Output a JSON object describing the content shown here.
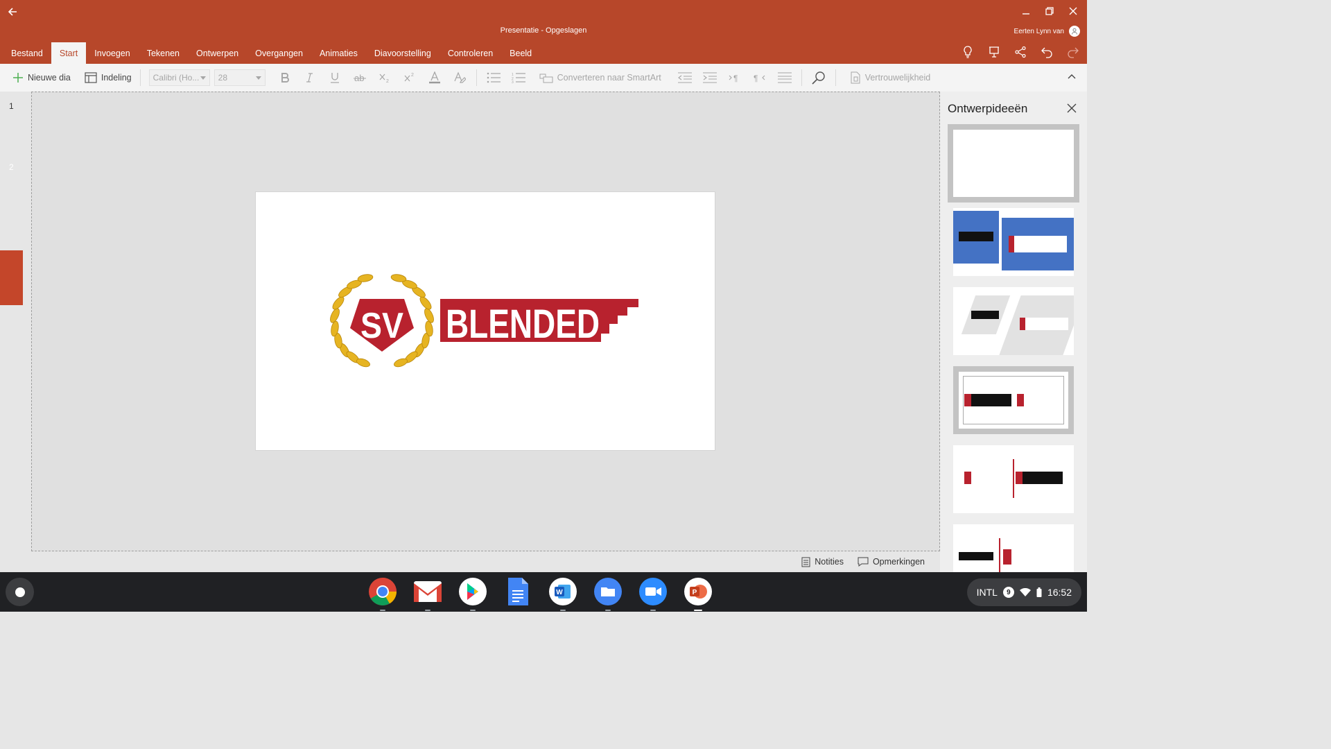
{
  "window": {
    "title": "Presentatie - Opgeslagen",
    "user_name": "Eerten Lynn van"
  },
  "ribbon": {
    "tabs": [
      {
        "label": "Bestand"
      },
      {
        "label": "Start",
        "active": true
      },
      {
        "label": "Invoegen"
      },
      {
        "label": "Tekenen"
      },
      {
        "label": "Ontwerpen"
      },
      {
        "label": "Overgangen"
      },
      {
        "label": "Animaties"
      },
      {
        "label": "Diavoorstelling"
      },
      {
        "label": "Controleren"
      },
      {
        "label": "Beeld"
      }
    ]
  },
  "toolbar": {
    "new_slide": "Nieuwe dia",
    "layout": "Indeling",
    "font_name": "Calibri (Ho...",
    "font_size": "28",
    "smartart": "Converteren naar SmartArt",
    "sensitivity": "Vertrouwelijkheid"
  },
  "slides_panel": {
    "numbers": [
      "1",
      "2"
    ],
    "selected": "2"
  },
  "slide": {
    "logo_monogram": "SV",
    "logo_word": "BLENDED"
  },
  "status_bar": {
    "notes": "Notities",
    "comments": "Opmerkingen"
  },
  "design_panel": {
    "title": "Ontwerpideeën",
    "selected_index": 3
  },
  "taskbar": {
    "apps": [
      "chrome-icon",
      "gmail-icon",
      "play-store-icon",
      "docs-icon",
      "word-icon",
      "files-icon",
      "zoom-icon",
      "powerpoint-icon"
    ],
    "keyboard": "INTL",
    "notification_count": "9",
    "time": "16:52"
  },
  "colors": {
    "accent": "#b7472a",
    "logo_red": "#b8222e",
    "logo_gold": "#e6b422",
    "design_blue": "#4472c4"
  }
}
